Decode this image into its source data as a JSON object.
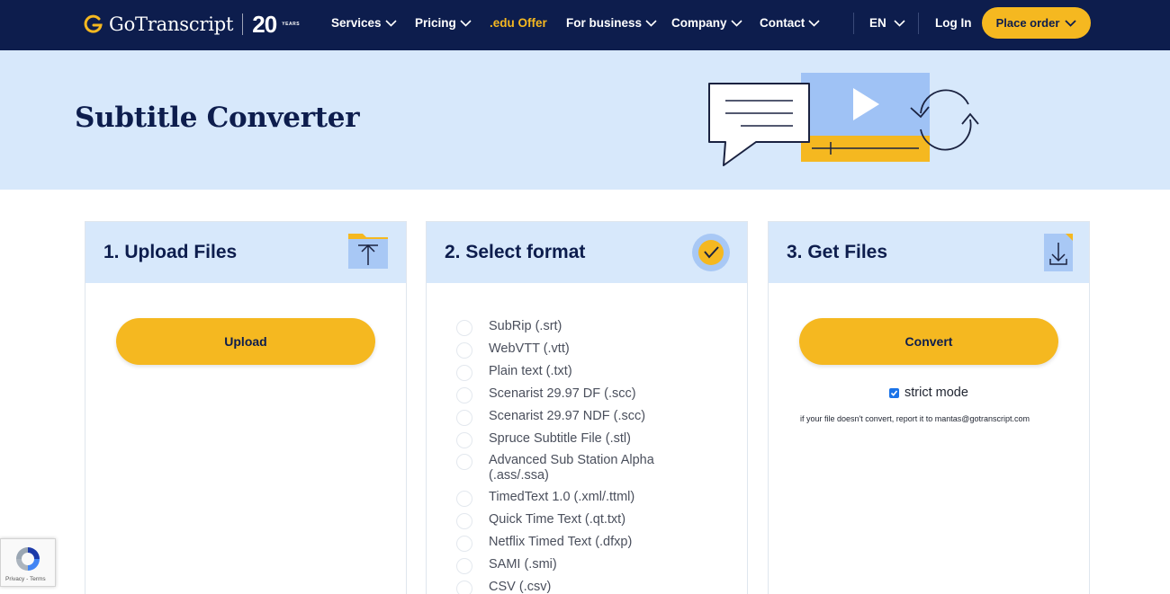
{
  "nav": {
    "logo_text": "GoTranscript",
    "logo_20": "20",
    "logo_years": "YEARS",
    "items": [
      {
        "label": "Services",
        "chevron": true
      },
      {
        "label": "Pricing",
        "chevron": true
      },
      {
        "label": ".edu Offer",
        "chevron": false
      },
      {
        "label": "For business",
        "chevron": true
      },
      {
        "label": "Company",
        "chevron": true
      },
      {
        "label": "Contact",
        "chevron": true
      }
    ],
    "language": "EN",
    "login": "Log In",
    "place_order": "Place order"
  },
  "hero": {
    "title": "Subtitle Converter"
  },
  "cards": {
    "upload": {
      "title": "1. Upload Files",
      "button": "Upload"
    },
    "format": {
      "title": "2. Select format",
      "options": [
        "SubRip (.srt)",
        "WebVTT (.vtt)",
        "Plain text (.txt)",
        "Scenarist 29.97 DF (.scc)",
        "Scenarist 29.97 NDF (.scc)",
        "Spruce Subtitle File (.stl)",
        "Advanced Sub Station Alpha (.ass/.ssa)",
        "TimedText 1.0 (.xml/.ttml)",
        "Quick Time Text (.qt.txt)",
        "Netflix Timed Text (.dfxp)",
        "SAMI (.smi)",
        "CSV (.csv)"
      ]
    },
    "get": {
      "title": "3. Get Files",
      "button": "Convert",
      "strict_label": "strict mode",
      "strict_checked": true,
      "note": "if your file doesn't convert, report it to mantas@gotranscript.com"
    }
  },
  "recaptcha": {
    "links": "Privacy - Terms"
  },
  "colors": {
    "navy": "#0d1d4d",
    "accent": "#f5b820",
    "light_blue": "#d7e8fb"
  }
}
